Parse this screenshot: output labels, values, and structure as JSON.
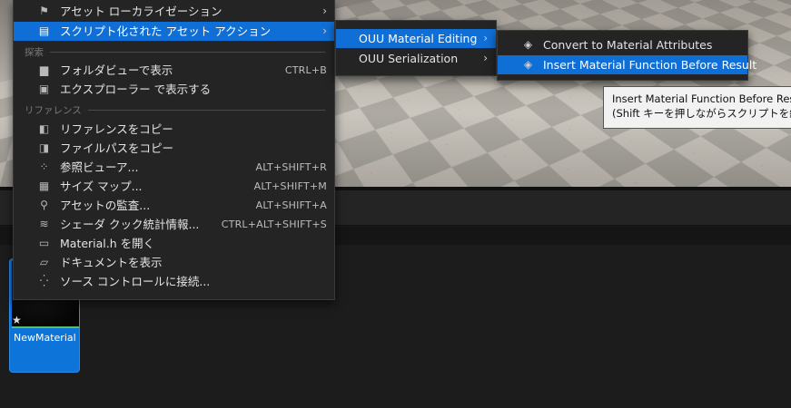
{
  "main_menu": {
    "top_items": [
      {
        "icon": "flag-icon",
        "label": "アセット ローカライゼーション",
        "has_submenu": true
      },
      {
        "icon": "script-icon",
        "label": "スクリプト化された アセット アクション",
        "has_submenu": true
      }
    ],
    "sections": [
      {
        "header": "探索",
        "items": [
          {
            "icon": "folder-icon",
            "label": "フォルダビューで表示",
            "shortcut": "CTRL+B"
          },
          {
            "icon": "explorer-icon",
            "label": "エクスプローラー で表示する",
            "shortcut": ""
          }
        ]
      },
      {
        "header": "リファレンス",
        "items": [
          {
            "icon": "copy-reference-icon",
            "label": "リファレンスをコピー",
            "shortcut": ""
          },
          {
            "icon": "copy-path-icon",
            "label": "ファイルパスをコピー",
            "shortcut": ""
          },
          {
            "icon": "reference-viewer-icon",
            "label": "参照ビューア...",
            "shortcut": "ALT+SHIFT+R"
          },
          {
            "icon": "size-map-icon",
            "label": "サイズ マップ...",
            "shortcut": "ALT+SHIFT+M"
          },
          {
            "icon": "audit-icon",
            "label": "アセットの監査...",
            "shortcut": "ALT+SHIFT+A"
          },
          {
            "icon": "shader-stats-icon",
            "label": "シェーダ クック統計情報...",
            "shortcut": "CTRL+ALT+SHIFT+S"
          },
          {
            "icon": "header-file-icon",
            "label": "Material.h を開く",
            "shortcut": ""
          },
          {
            "icon": "documentation-icon",
            "label": "ドキュメントを表示",
            "shortcut": ""
          },
          {
            "icon": "source-control-icon",
            "label": "ソース コントロールに接続...",
            "shortcut": ""
          }
        ]
      }
    ]
  },
  "submenu_1": {
    "items": [
      {
        "label": "OUU Material Editing",
        "has_submenu": true
      },
      {
        "label": "OUU Serialization",
        "has_submenu": true
      }
    ]
  },
  "submenu_2": {
    "items": [
      {
        "icon": "action-diamond-icon",
        "label": "Convert to Material Attributes"
      },
      {
        "icon": "action-diamond-icon",
        "label": "Insert Material Function Before Result"
      }
    ]
  },
  "tooltip": {
    "line1": "Insert Material Function Before Resu",
    "line2": "(Shift キーを押しながらスクリプトを編"
  },
  "asset_tile": {
    "label": "NewMaterial"
  },
  "glyphs": {
    "submenu_arrow": "›",
    "flag": "⚑",
    "script": "▤",
    "folder": "▆",
    "explorer": "▣",
    "copy_reference": "◧",
    "copy_path": "◨",
    "reference_viewer": "⁘",
    "size_map": "▦",
    "audit": "⚲",
    "shader_stats": "≋",
    "header_file": "▭",
    "documentation": "▱",
    "source_control": "⁛",
    "action_diamond": "◈",
    "star": "★"
  }
}
